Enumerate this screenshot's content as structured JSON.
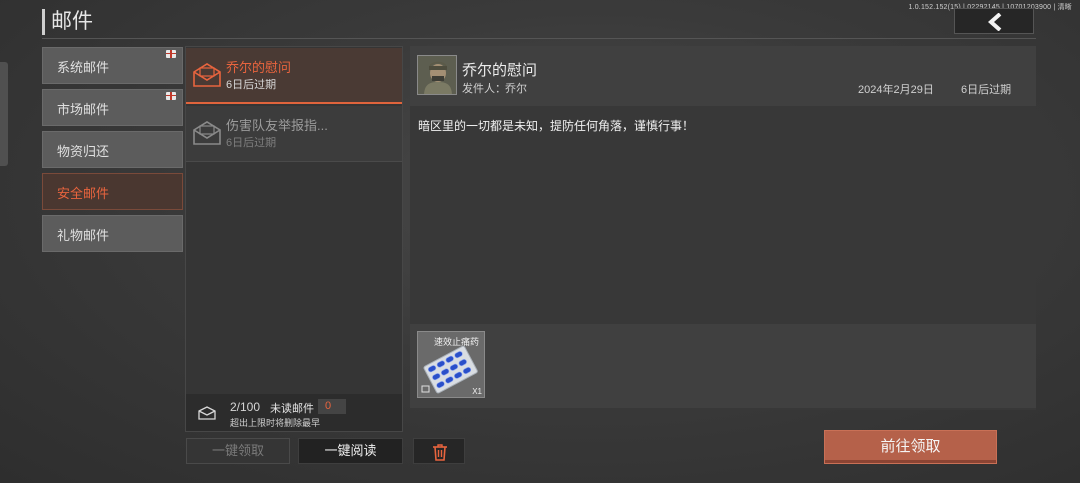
{
  "header": {
    "title": "邮件",
    "version": "1.0.152.152(15) | 02292145 | 10701203900 | 清晰"
  },
  "categories": [
    {
      "label": "系统邮件",
      "gift": true,
      "active": false
    },
    {
      "label": "市场邮件",
      "gift": true,
      "active": false
    },
    {
      "label": "物资归还",
      "gift": false,
      "active": false
    },
    {
      "label": "安全邮件",
      "gift": false,
      "active": true
    },
    {
      "label": "礼物邮件",
      "gift": false,
      "active": false
    }
  ],
  "mails": [
    {
      "subject": "乔尔的慰问",
      "expiry": "6日后过期",
      "state": "active"
    },
    {
      "subject": "伤害队友举报指...",
      "expiry": "6日后过期",
      "state": "read"
    }
  ],
  "footer": {
    "count": "2/100",
    "unread_label": "未读邮件",
    "unread_count": "0",
    "warning": "超出上限时将删除最早"
  },
  "buttons": {
    "claim_all": "一键领取",
    "read_all": "一键阅读",
    "claim": "前往领取"
  },
  "detail": {
    "subject": "乔尔的慰问",
    "sender_label": "发件人：",
    "sender": "乔尔",
    "date": "2024年2月29日",
    "expiry": "6日后过期",
    "body": "暗区里的一切都是未知，提防任何角落，谨慎行事！",
    "attachment": {
      "name": "速效止痛药",
      "qty": "X1"
    }
  },
  "colors": {
    "accent": "#e8643e",
    "claim_button": "#b5614a"
  }
}
